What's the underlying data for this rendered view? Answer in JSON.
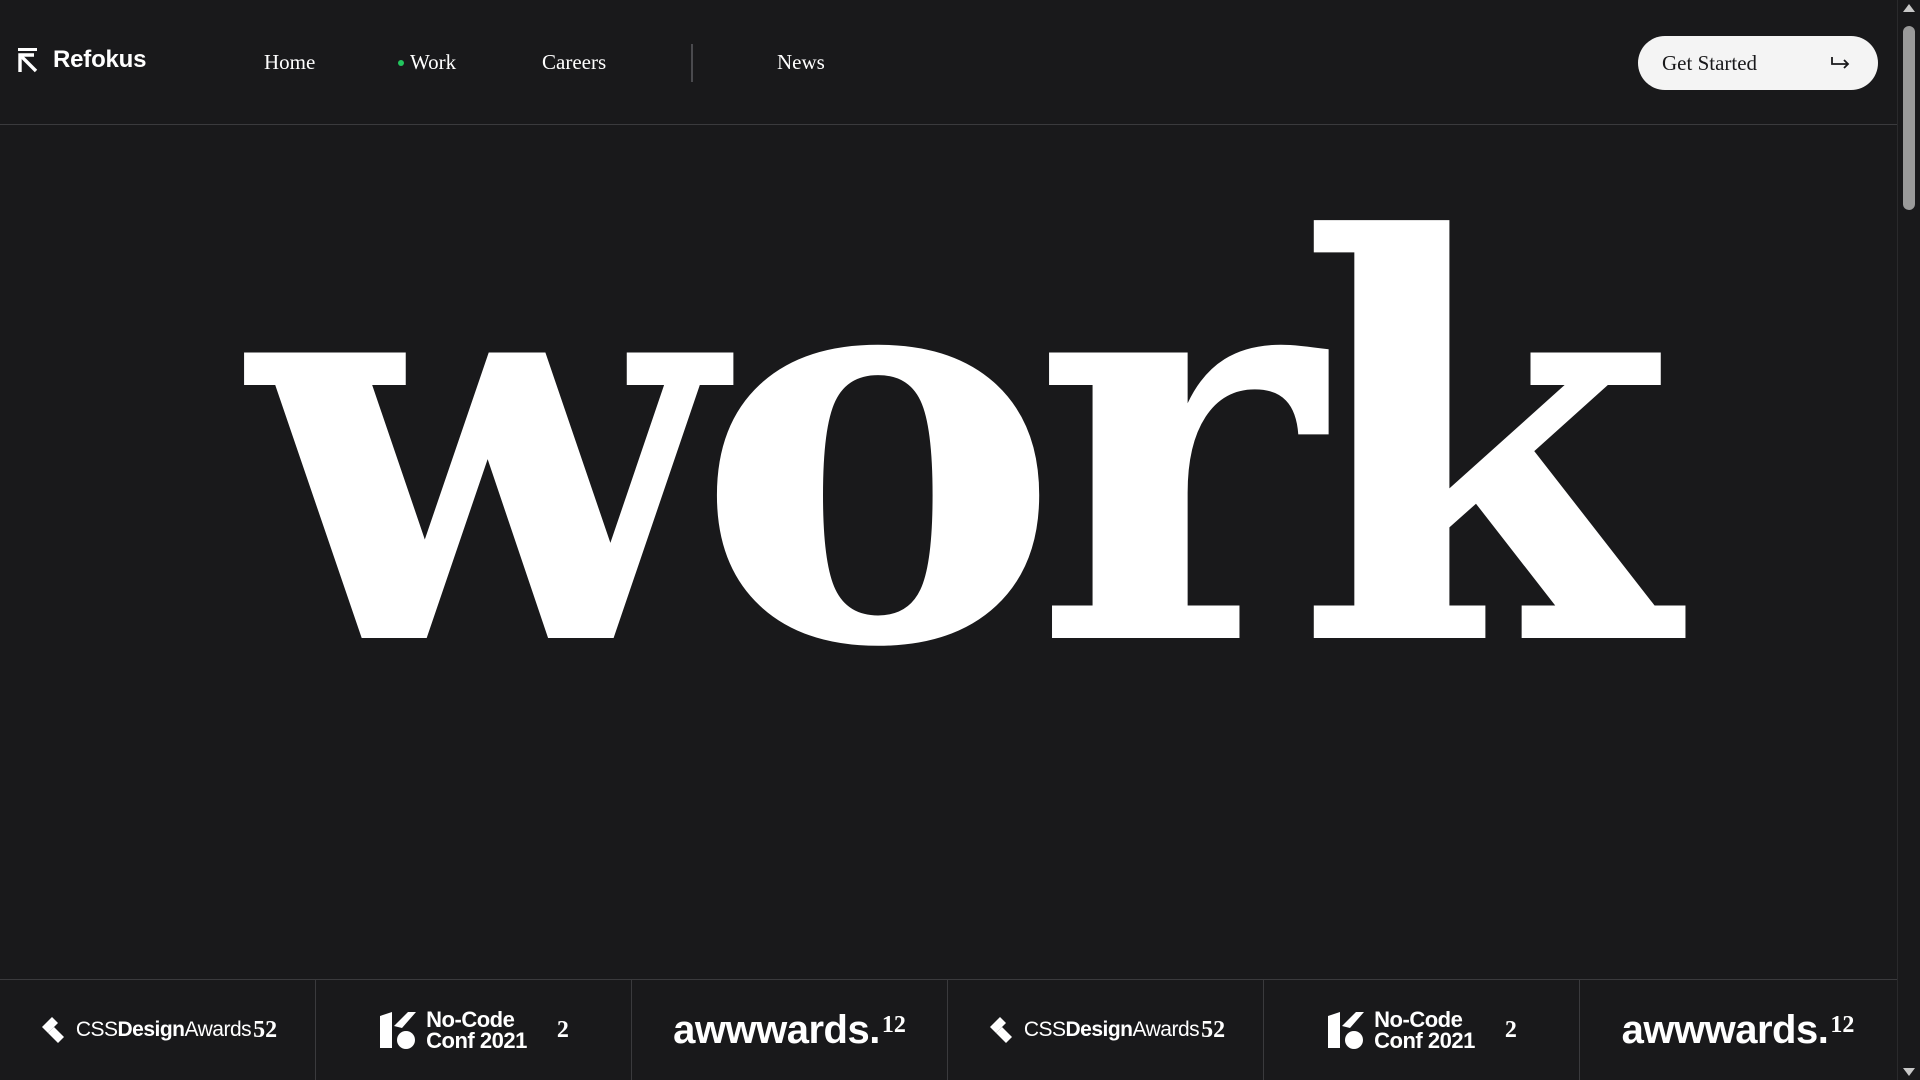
{
  "brand": {
    "name": "Refokus",
    "icon": "refokus-logo-icon"
  },
  "nav": {
    "items": [
      {
        "label": "Home",
        "active": false
      },
      {
        "label": "Work",
        "active": true
      },
      {
        "label": "Careers",
        "active": false
      },
      {
        "label": "News",
        "active": false
      }
    ],
    "active_indicator_color": "#22c55e"
  },
  "cta": {
    "label": "Get Started",
    "icon": "return-arrow-icon"
  },
  "hero": {
    "title": "work"
  },
  "awards": [
    {
      "type": "cssdesignawards",
      "prefix": "CSS",
      "bold": "Design",
      "suffix": "Awards",
      "count": "52"
    },
    {
      "type": "nocode",
      "line1": "No-Code",
      "line2": "Conf 2021",
      "count": "2"
    },
    {
      "type": "awwwards",
      "label": "awwwards.",
      "count": "12"
    },
    {
      "type": "cssdesignawards",
      "prefix": "CSS",
      "bold": "Design",
      "suffix": "Awards",
      "count": "52"
    },
    {
      "type": "nocode",
      "line1": "No-Code",
      "line2": "Conf 2021",
      "count": "2"
    },
    {
      "type": "awwwards",
      "label": "awwwards.",
      "count": "12"
    }
  ],
  "colors": {
    "background": "#19191b",
    "text": "#ffffff",
    "cta_bg": "#f4f4f4",
    "divider": "#3a3a3d"
  }
}
